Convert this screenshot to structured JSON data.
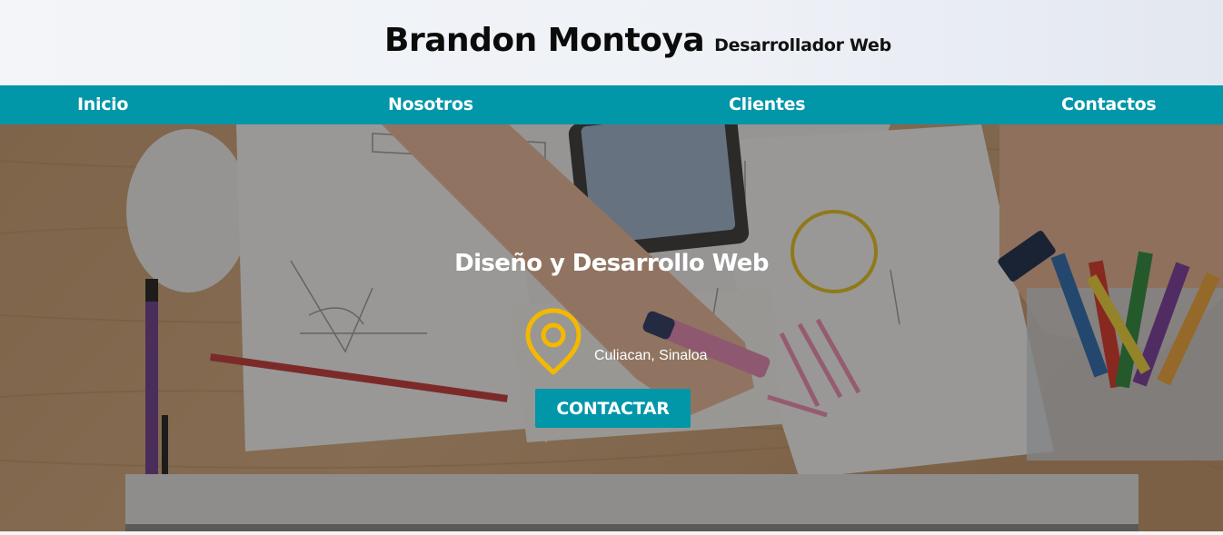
{
  "header": {
    "name": "Brandon Montoya",
    "role": "Desarrollador Web"
  },
  "nav": {
    "items": [
      {
        "label": "Inicio"
      },
      {
        "label": "Nosotros"
      },
      {
        "label": "Clientes"
      },
      {
        "label": "Contactos"
      }
    ]
  },
  "hero": {
    "title": "Diseño y Desarrollo Web",
    "location_icon": "map-pin-icon",
    "location": "Culiacan, Sinaloa",
    "button_label": "CONTACTAR"
  },
  "colors": {
    "accent": "#0196a8",
    "pin": "#f5b800",
    "header_bg": "#eef1f6"
  }
}
